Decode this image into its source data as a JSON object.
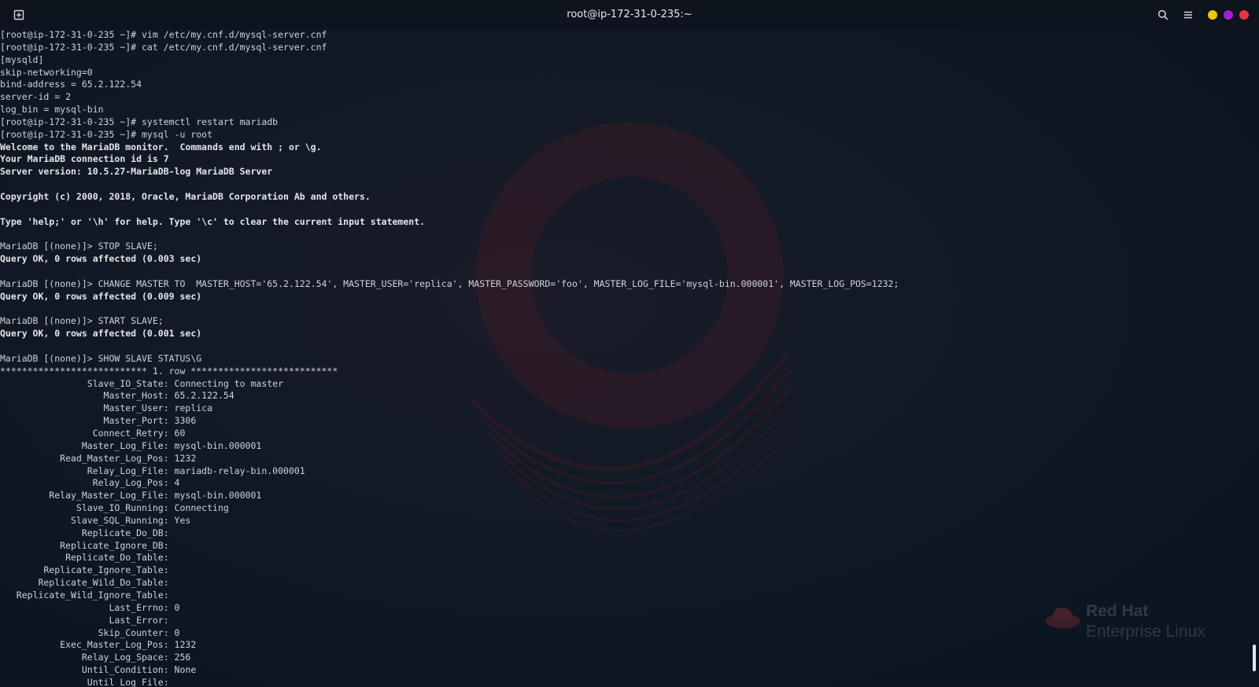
{
  "window": {
    "title": "root@ip-172-31-0-235:~"
  },
  "icons": {
    "new_tab": "new-tab-icon",
    "search": "search-icon",
    "menu": "hamburger-menu-icon"
  },
  "colors": {
    "titlebar": "#0d141d",
    "background": "#0c1623",
    "text": "#cfd3d8",
    "minimize": "#f5c400",
    "maximize": "#a51fd6",
    "close": "#e8343f"
  },
  "watermark": {
    "line1": "Red Hat",
    "line2": "Enterprise Linux"
  },
  "terminal": {
    "lines": [
      {
        "text": "[root@ip-172-31-0-235 ~]# vim /etc/my.cnf.d/mysql-server.cnf"
      },
      {
        "text": "[root@ip-172-31-0-235 ~]# cat /etc/my.cnf.d/mysql-server.cnf"
      },
      {
        "text": "[mysqld]"
      },
      {
        "text": "skip-networking=0"
      },
      {
        "text": "bind-address = 65.2.122.54"
      },
      {
        "text": "server-id = 2"
      },
      {
        "text": "log_bin = mysql-bin"
      },
      {
        "text": "[root@ip-172-31-0-235 ~]# systemctl restart mariadb"
      },
      {
        "text": "[root@ip-172-31-0-235 ~]# mysql -u root"
      },
      {
        "text": "Welcome to the MariaDB monitor.  Commands end with ; or \\g.",
        "bold": true
      },
      {
        "text": "Your MariaDB connection id is 7",
        "bold": true
      },
      {
        "text": "Server version: 10.5.27-MariaDB-log MariaDB Server",
        "bold": true
      },
      {
        "text": ""
      },
      {
        "text": "Copyright (c) 2000, 2018, Oracle, MariaDB Corporation Ab and others.",
        "bold": true
      },
      {
        "text": ""
      },
      {
        "text": "Type 'help;' or '\\h' for help. Type '\\c' to clear the current input statement.",
        "bold": true
      },
      {
        "text": ""
      },
      {
        "text": "MariaDB [(none)]> STOP SLAVE;"
      },
      {
        "text": "Query OK, 0 rows affected (0.003 sec)",
        "bold": true
      },
      {
        "text": ""
      },
      {
        "text": "MariaDB [(none)]> CHANGE MASTER TO  MASTER_HOST='65.2.122.54', MASTER_USER='replica', MASTER_PASSWORD='foo', MASTER_LOG_FILE='mysql-bin.000001', MASTER_LOG_POS=1232;"
      },
      {
        "text": "Query OK, 0 rows affected (0.009 sec)",
        "bold": true
      },
      {
        "text": ""
      },
      {
        "text": "MariaDB [(none)]> START SLAVE;"
      },
      {
        "text": "Query OK, 0 rows affected (0.001 sec)",
        "bold": true
      },
      {
        "text": ""
      },
      {
        "text": "MariaDB [(none)]> SHOW SLAVE STATUS\\G"
      },
      {
        "text": "*************************** 1. row ***************************"
      },
      {
        "text": "                Slave_IO_State: Connecting to master"
      },
      {
        "text": "                   Master_Host: 65.2.122.54"
      },
      {
        "text": "                   Master_User: replica"
      },
      {
        "text": "                   Master_Port: 3306"
      },
      {
        "text": "                 Connect_Retry: 60"
      },
      {
        "text": "               Master_Log_File: mysql-bin.000001"
      },
      {
        "text": "           Read_Master_Log_Pos: 1232"
      },
      {
        "text": "                Relay_Log_File: mariadb-relay-bin.000001"
      },
      {
        "text": "                 Relay_Log_Pos: 4"
      },
      {
        "text": "         Relay_Master_Log_File: mysql-bin.000001"
      },
      {
        "text": "              Slave_IO_Running: Connecting"
      },
      {
        "text": "             Slave_SQL_Running: Yes"
      },
      {
        "text": "               Replicate_Do_DB: "
      },
      {
        "text": "           Replicate_Ignore_DB: "
      },
      {
        "text": "            Replicate_Do_Table: "
      },
      {
        "text": "        Replicate_Ignore_Table: "
      },
      {
        "text": "       Replicate_Wild_Do_Table: "
      },
      {
        "text": "   Replicate_Wild_Ignore_Table: "
      },
      {
        "text": "                    Last_Errno: 0"
      },
      {
        "text": "                    Last_Error: "
      },
      {
        "text": "                  Skip_Counter: 0"
      },
      {
        "text": "           Exec_Master_Log_Pos: 1232"
      },
      {
        "text": "               Relay_Log_Space: 256"
      },
      {
        "text": "               Until_Condition: None"
      },
      {
        "text": "                Until_Log_File: "
      }
    ]
  }
}
